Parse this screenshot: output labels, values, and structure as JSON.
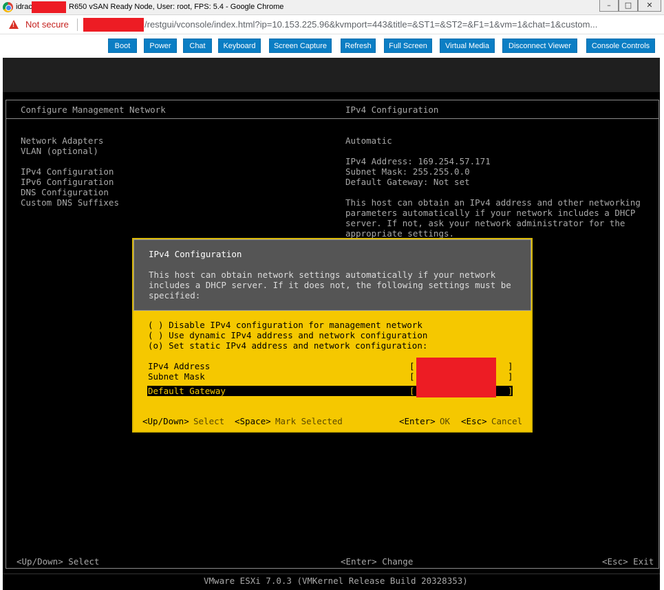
{
  "window": {
    "title_prefix": "idrac",
    "title_suffix": "R650 vSAN Ready Node, User: root, FPS: 5.4 - Google Chrome",
    "minimize": "–",
    "maximize": "□",
    "close": "✕"
  },
  "address_bar": {
    "security_label": "Not secure",
    "url": "/restgui/vconsole/index.html?ip=10.153.225.96&kvmport=443&title=&ST1=&ST2=&F1=1&vm=1&chat=1&custom..."
  },
  "toolbar": {
    "buttons": [
      "Boot",
      "Power",
      "Chat",
      "Keyboard",
      "Screen Capture",
      "Refresh",
      "Full Screen",
      "Virtual Media",
      "Disconnect Viewer",
      "Console Controls"
    ]
  },
  "dcui": {
    "left_header": "Configure Management Network",
    "right_header": "IPv4 Configuration",
    "menu": {
      "network_adapters": "Network Adapters",
      "vlan": "VLAN (optional)",
      "ipv4": "IPv4 Configuration",
      "ipv6": "IPv6 Configuration",
      "dns": "DNS Configuration",
      "dns_suffixes": "Custom DNS Suffixes"
    },
    "info": {
      "mode": "Automatic",
      "ipv4_address": "IPv4 Address: 169.254.57.171",
      "subnet_mask": "Subnet Mask: 255.255.0.0",
      "gateway": "Default Gateway: Not set",
      "help_1": "This host can obtain an IPv4 address and other networking",
      "help_2": "parameters automatically if your network includes a DHCP",
      "help_3": "server. If not, ask your network administrator for the",
      "help_4": "appropriate settings."
    },
    "footer": {
      "nav": "<Up/Down> Select",
      "change": "<Enter> Change",
      "exit": "<Esc> Exit"
    },
    "version": "VMware ESXi 7.0.3 (VMKernel Release Build 20328353)"
  },
  "dialog": {
    "title": "IPv4 Configuration",
    "desc_1": "This host can obtain network settings automatically if your network",
    "desc_2": "includes a DHCP server. If it does not, the following settings must be",
    "desc_3": "specified:",
    "options": [
      "( ) Disable IPv4 configuration for management network",
      "( ) Use dynamic IPv4 address and network configuration",
      "(o) Set static IPv4 address and network configuration:"
    ],
    "fields": {
      "ipv4_label": "IPv4 Address",
      "subnet_label": "Subnet Mask",
      "gateway_label": "Default Gateway",
      "bracket_open": "[",
      "bracket_close": "]"
    },
    "keys": {
      "updown": "<Up/Down>",
      "select": "Select",
      "space": "<Space>",
      "mark": "Mark Selected",
      "enter": "<Enter>",
      "ok": "OK",
      "esc": "<Esc>",
      "cancel": "Cancel"
    }
  },
  "colors": {
    "toolbar_button": "#0b7ec4",
    "dialog_body": "#f5c800",
    "dialog_header": "#555555",
    "console_bg": "#000000",
    "redaction": "#ed1c24"
  }
}
